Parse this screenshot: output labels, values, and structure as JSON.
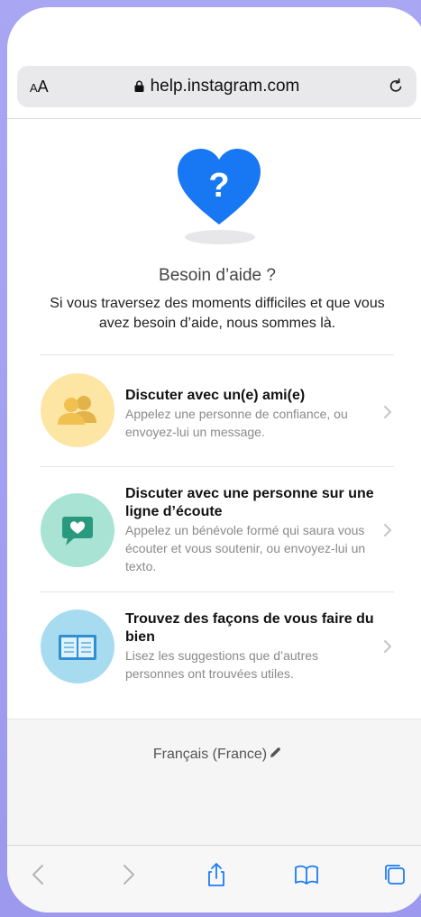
{
  "browser": {
    "text_size_label_small": "A",
    "text_size_label_large": "A",
    "url": "help.instagram.com"
  },
  "hero": {
    "title": "Besoin d’aide ?",
    "subtitle": "Si vous traversez des moments difficiles et que vous avez besoin d’aide, nous sommes là."
  },
  "options": [
    {
      "title": "Discuter avec un(e) ami(e)",
      "description": "Appelez une personne de confiance, ou envoyez-lui un message.",
      "icon": "friends-icon",
      "color": "#fde5a3"
    },
    {
      "title": "Discuter avec une personne sur une ligne d’écoute",
      "description": "Appelez un bénévole formé qui saura vous écouter et vous soutenir, ou envoyez-lui un texto.",
      "icon": "chat-heart-icon",
      "color": "#a8e3d4"
    },
    {
      "title": "Trouvez des façons de vous faire du bien",
      "description": "Lisez les suggestions que d’autres personnes ont trouvées utiles.",
      "icon": "open-book-icon",
      "color": "#a7dcf0"
    }
  ],
  "footer": {
    "language": "Français (France)"
  },
  "colors": {
    "accent_blue": "#1877f2",
    "background": "#a9a7f3"
  }
}
